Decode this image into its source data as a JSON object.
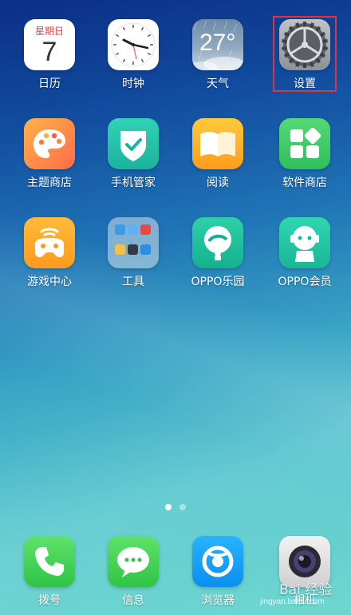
{
  "apps_row1": [
    {
      "label": "日历",
      "icon": "calendar-icon",
      "weekday": "星期日",
      "day": "7"
    },
    {
      "label": "时钟",
      "icon": "clock-icon"
    },
    {
      "label": "天气",
      "icon": "weather-icon",
      "temp": "27°"
    },
    {
      "label": "设置",
      "icon": "gear-icon"
    }
  ],
  "apps_row2": [
    {
      "label": "主题商店",
      "icon": "palette-icon"
    },
    {
      "label": "手机管家",
      "icon": "shield-check-icon"
    },
    {
      "label": "阅读",
      "icon": "book-icon"
    },
    {
      "label": "软件商店",
      "icon": "app-grid-icon"
    }
  ],
  "apps_row3": [
    {
      "label": "游戏中心",
      "icon": "gamepad-icon"
    },
    {
      "label": "工具",
      "icon": "folder-icon"
    },
    {
      "label": "OPPO乐园",
      "icon": "balloon-icon"
    },
    {
      "label": "OPPO会员",
      "icon": "robot-icon"
    }
  ],
  "dock": [
    {
      "label": "拨号",
      "icon": "phone-icon"
    },
    {
      "label": "信息",
      "icon": "message-icon"
    },
    {
      "label": "浏览器",
      "icon": "browser-icon"
    },
    {
      "label": "相机",
      "icon": "camera-icon"
    }
  ],
  "pager": {
    "pages": 2,
    "current": 1
  },
  "watermark": {
    "brand": "Bai 经验",
    "url": "jingyan.baidu.com"
  },
  "colors": {
    "highlight": "#e0363a",
    "accent_red": "#e9473f"
  }
}
